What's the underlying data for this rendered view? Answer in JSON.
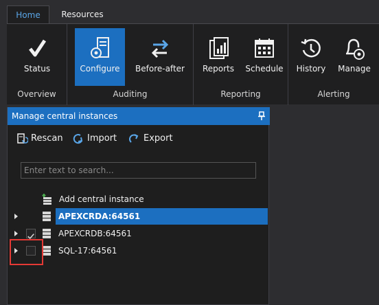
{
  "tabs": [
    {
      "label": "Home",
      "active": true
    },
    {
      "label": "Resources",
      "active": false
    }
  ],
  "ribbon": {
    "groups": [
      {
        "label": "Overview",
        "buttons": [
          {
            "label": "Status",
            "icon": "checkmark-icon"
          }
        ]
      },
      {
        "label": "Auditing",
        "buttons": [
          {
            "label": "Configure",
            "icon": "server-gear-icon",
            "active": true
          },
          {
            "label": "Before-after",
            "icon": "swap-arrows-icon"
          }
        ]
      },
      {
        "label": "Reporting",
        "buttons": [
          {
            "label": "Reports",
            "icon": "report-chart-icon"
          },
          {
            "label": "Schedule",
            "icon": "calendar-icon"
          }
        ]
      },
      {
        "label": "Alerting",
        "buttons": [
          {
            "label": "History",
            "icon": "history-icon"
          },
          {
            "label": "Manage",
            "icon": "bell-gear-icon"
          }
        ]
      }
    ]
  },
  "panel": {
    "title": "Manage central instances",
    "toolbar": {
      "rescan": "Rescan",
      "import": "Import",
      "export": "Export"
    },
    "search_placeholder": "Enter text to search...",
    "tree": [
      {
        "label": "Add central instance",
        "type": "add",
        "checked": false
      },
      {
        "label": "APEXCRDA:64561",
        "type": "server",
        "selected": true,
        "checked": false
      },
      {
        "label": "APEXCRDB:64561",
        "type": "server",
        "selected": false,
        "checked": true
      },
      {
        "label": "SQL-17:64561",
        "type": "server",
        "selected": false,
        "checked": false
      }
    ]
  },
  "colors": {
    "accent": "#1c6fc0",
    "background": "#2d2d30",
    "ribbon": "#1f1f20",
    "highlight": "#e53935"
  }
}
